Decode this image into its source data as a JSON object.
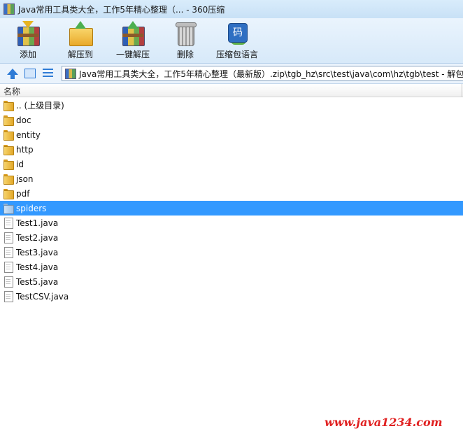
{
  "window": {
    "title": "Java常用工具类大全，工作5年精心整理（... - 360压缩"
  },
  "toolbar": {
    "buttons": [
      {
        "label": "添加",
        "icon": "add-archive-icon"
      },
      {
        "label": "解压到",
        "icon": "extract-to-icon"
      },
      {
        "label": "一键解压",
        "icon": "one-click-extract-icon"
      },
      {
        "label": "删除",
        "icon": "delete-trash-icon"
      },
      {
        "label": "压缩包语言",
        "icon": "archive-encoding-icon"
      }
    ],
    "encoding_glyph": "码"
  },
  "addressbar": {
    "path": "Java常用工具类大全，工作5年精心整理（最新版）.zip\\tgb_hz\\src\\test\\java\\com\\hz\\tgb\\test - 解包大小"
  },
  "list": {
    "column_name": "名称",
    "items": [
      {
        "name": ".. (上级目录)",
        "type": "folder"
      },
      {
        "name": "doc",
        "type": "folder"
      },
      {
        "name": "entity",
        "type": "folder"
      },
      {
        "name": "http",
        "type": "folder"
      },
      {
        "name": "id",
        "type": "folder"
      },
      {
        "name": "json",
        "type": "folder"
      },
      {
        "name": "pdf",
        "type": "folder"
      },
      {
        "name": "spiders",
        "type": "folder",
        "selected": true
      },
      {
        "name": "Test1.java",
        "type": "file"
      },
      {
        "name": "Test2.java",
        "type": "file"
      },
      {
        "name": "Test3.java",
        "type": "file"
      },
      {
        "name": "Test4.java",
        "type": "file"
      },
      {
        "name": "Test5.java",
        "type": "file"
      },
      {
        "name": "TestCSV.java",
        "type": "file"
      }
    ]
  },
  "watermark": "www.java1234.com",
  "colors": {
    "selection": "#3399ff",
    "watermark": "#e02020"
  }
}
